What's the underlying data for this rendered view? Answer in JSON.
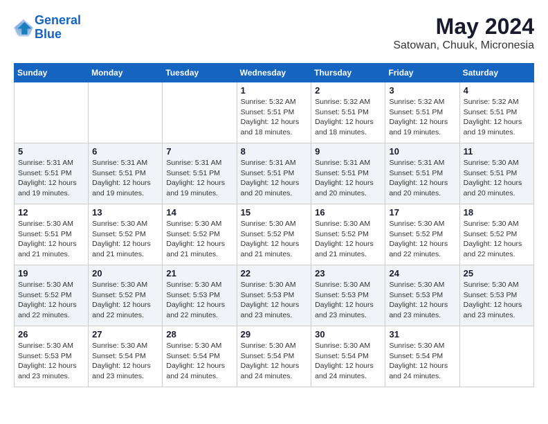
{
  "header": {
    "logo_line1": "General",
    "logo_line2": "Blue",
    "month": "May 2024",
    "location": "Satowan, Chuuk, Micronesia"
  },
  "weekdays": [
    "Sunday",
    "Monday",
    "Tuesday",
    "Wednesday",
    "Thursday",
    "Friday",
    "Saturday"
  ],
  "weeks": [
    [
      {
        "day": "",
        "info": ""
      },
      {
        "day": "",
        "info": ""
      },
      {
        "day": "",
        "info": ""
      },
      {
        "day": "1",
        "info": "Sunrise: 5:32 AM\nSunset: 5:51 PM\nDaylight: 12 hours\nand 18 minutes."
      },
      {
        "day": "2",
        "info": "Sunrise: 5:32 AM\nSunset: 5:51 PM\nDaylight: 12 hours\nand 18 minutes."
      },
      {
        "day": "3",
        "info": "Sunrise: 5:32 AM\nSunset: 5:51 PM\nDaylight: 12 hours\nand 19 minutes."
      },
      {
        "day": "4",
        "info": "Sunrise: 5:32 AM\nSunset: 5:51 PM\nDaylight: 12 hours\nand 19 minutes."
      }
    ],
    [
      {
        "day": "5",
        "info": "Sunrise: 5:31 AM\nSunset: 5:51 PM\nDaylight: 12 hours\nand 19 minutes."
      },
      {
        "day": "6",
        "info": "Sunrise: 5:31 AM\nSunset: 5:51 PM\nDaylight: 12 hours\nand 19 minutes."
      },
      {
        "day": "7",
        "info": "Sunrise: 5:31 AM\nSunset: 5:51 PM\nDaylight: 12 hours\nand 19 minutes."
      },
      {
        "day": "8",
        "info": "Sunrise: 5:31 AM\nSunset: 5:51 PM\nDaylight: 12 hours\nand 20 minutes."
      },
      {
        "day": "9",
        "info": "Sunrise: 5:31 AM\nSunset: 5:51 PM\nDaylight: 12 hours\nand 20 minutes."
      },
      {
        "day": "10",
        "info": "Sunrise: 5:31 AM\nSunset: 5:51 PM\nDaylight: 12 hours\nand 20 minutes."
      },
      {
        "day": "11",
        "info": "Sunrise: 5:30 AM\nSunset: 5:51 PM\nDaylight: 12 hours\nand 20 minutes."
      }
    ],
    [
      {
        "day": "12",
        "info": "Sunrise: 5:30 AM\nSunset: 5:51 PM\nDaylight: 12 hours\nand 21 minutes."
      },
      {
        "day": "13",
        "info": "Sunrise: 5:30 AM\nSunset: 5:52 PM\nDaylight: 12 hours\nand 21 minutes."
      },
      {
        "day": "14",
        "info": "Sunrise: 5:30 AM\nSunset: 5:52 PM\nDaylight: 12 hours\nand 21 minutes."
      },
      {
        "day": "15",
        "info": "Sunrise: 5:30 AM\nSunset: 5:52 PM\nDaylight: 12 hours\nand 21 minutes."
      },
      {
        "day": "16",
        "info": "Sunrise: 5:30 AM\nSunset: 5:52 PM\nDaylight: 12 hours\nand 21 minutes."
      },
      {
        "day": "17",
        "info": "Sunrise: 5:30 AM\nSunset: 5:52 PM\nDaylight: 12 hours\nand 22 minutes."
      },
      {
        "day": "18",
        "info": "Sunrise: 5:30 AM\nSunset: 5:52 PM\nDaylight: 12 hours\nand 22 minutes."
      }
    ],
    [
      {
        "day": "19",
        "info": "Sunrise: 5:30 AM\nSunset: 5:52 PM\nDaylight: 12 hours\nand 22 minutes."
      },
      {
        "day": "20",
        "info": "Sunrise: 5:30 AM\nSunset: 5:52 PM\nDaylight: 12 hours\nand 22 minutes."
      },
      {
        "day": "21",
        "info": "Sunrise: 5:30 AM\nSunset: 5:53 PM\nDaylight: 12 hours\nand 22 minutes."
      },
      {
        "day": "22",
        "info": "Sunrise: 5:30 AM\nSunset: 5:53 PM\nDaylight: 12 hours\nand 23 minutes."
      },
      {
        "day": "23",
        "info": "Sunrise: 5:30 AM\nSunset: 5:53 PM\nDaylight: 12 hours\nand 23 minutes."
      },
      {
        "day": "24",
        "info": "Sunrise: 5:30 AM\nSunset: 5:53 PM\nDaylight: 12 hours\nand 23 minutes."
      },
      {
        "day": "25",
        "info": "Sunrise: 5:30 AM\nSunset: 5:53 PM\nDaylight: 12 hours\nand 23 minutes."
      }
    ],
    [
      {
        "day": "26",
        "info": "Sunrise: 5:30 AM\nSunset: 5:53 PM\nDaylight: 12 hours\nand 23 minutes."
      },
      {
        "day": "27",
        "info": "Sunrise: 5:30 AM\nSunset: 5:54 PM\nDaylight: 12 hours\nand 23 minutes."
      },
      {
        "day": "28",
        "info": "Sunrise: 5:30 AM\nSunset: 5:54 PM\nDaylight: 12 hours\nand 24 minutes."
      },
      {
        "day": "29",
        "info": "Sunrise: 5:30 AM\nSunset: 5:54 PM\nDaylight: 12 hours\nand 24 minutes."
      },
      {
        "day": "30",
        "info": "Sunrise: 5:30 AM\nSunset: 5:54 PM\nDaylight: 12 hours\nand 24 minutes."
      },
      {
        "day": "31",
        "info": "Sunrise: 5:30 AM\nSunset: 5:54 PM\nDaylight: 12 hours\nand 24 minutes."
      },
      {
        "day": "",
        "info": ""
      }
    ]
  ]
}
